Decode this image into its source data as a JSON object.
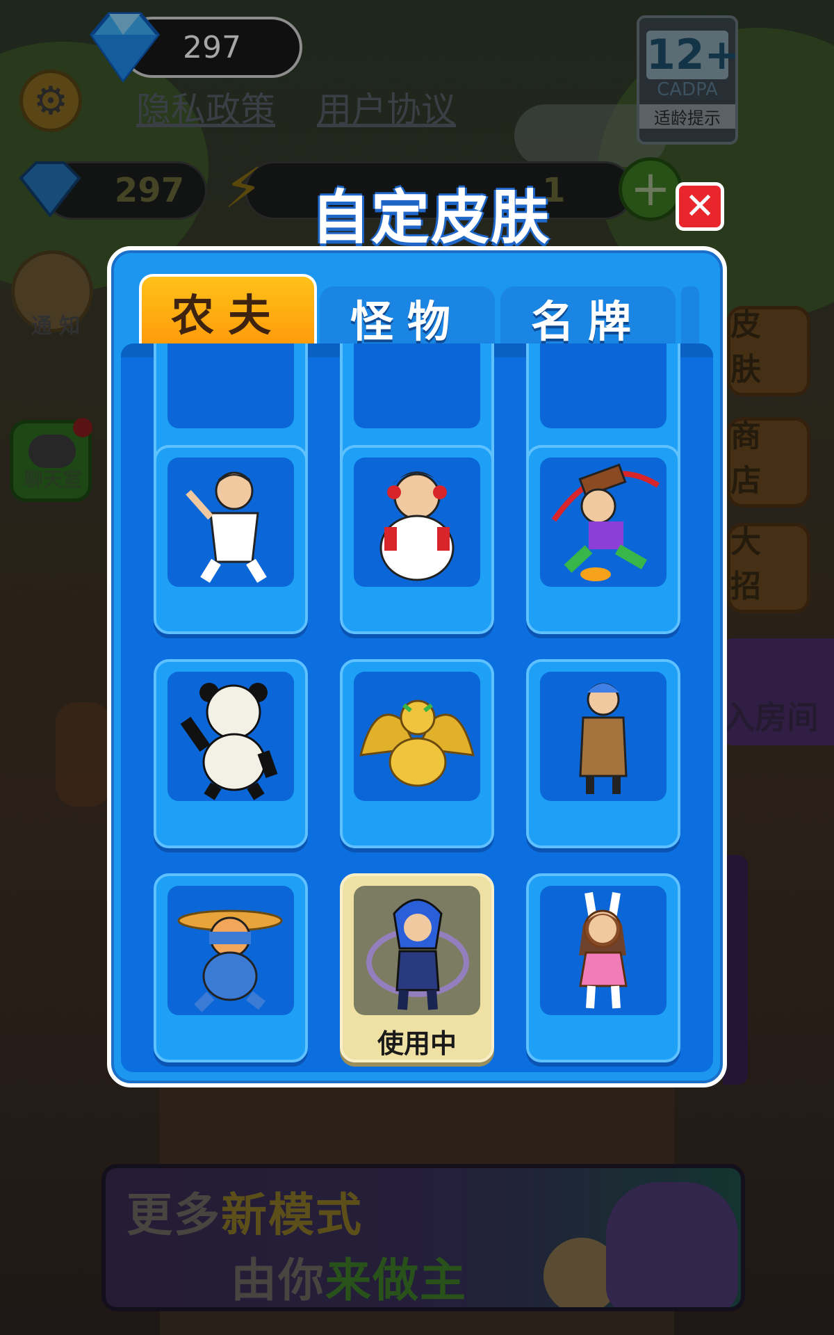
{
  "hud": {
    "gem_count": "297",
    "privacy_link": "隐私政策",
    "user_agreement_link": "用户协议",
    "age_rating": {
      "number": "12+",
      "org": "CADPA",
      "tip": "适龄提示"
    },
    "resource_gems": "297",
    "resource_keys": "1"
  },
  "left_menu": {
    "notice": "通 知",
    "chat": "聊天室"
  },
  "right_menu": {
    "skin": "皮 肤",
    "shop": "商 店",
    "ultimate": "大 招",
    "join_room": "入房间"
  },
  "banner": {
    "line1_prefix": "更多",
    "line1_highlight": "新模式",
    "line2_prefix": "由你",
    "line2_highlight": "来做主"
  },
  "modal": {
    "title": "自定皮肤",
    "close_icon": "close-icon",
    "tabs": [
      {
        "label": "农夫",
        "active": true
      },
      {
        "label": "怪物",
        "active": false
      },
      {
        "label": "名牌",
        "active": false
      }
    ],
    "skins": [
      {
        "id": "skin-kungfu-man",
        "label": ""
      },
      {
        "id": "skin-opera-lady",
        "label": ""
      },
      {
        "id": "skin-hammer-boy",
        "label": ""
      },
      {
        "id": "skin-panda-meme",
        "label": ""
      },
      {
        "id": "skin-golden-dragon",
        "label": ""
      },
      {
        "id": "skin-coat-man",
        "label": ""
      },
      {
        "id": "skin-farmer-boy",
        "label": ""
      },
      {
        "id": "skin-blue-swordsman",
        "label": "使用中",
        "selected": true
      },
      {
        "id": "skin-bunny-girl",
        "label": ""
      }
    ]
  },
  "colors": {
    "modal_blue": "#1b97f0",
    "tab_active": "#ff9a0a",
    "close_red": "#e8262b",
    "selected_card": "#efe1a3"
  }
}
